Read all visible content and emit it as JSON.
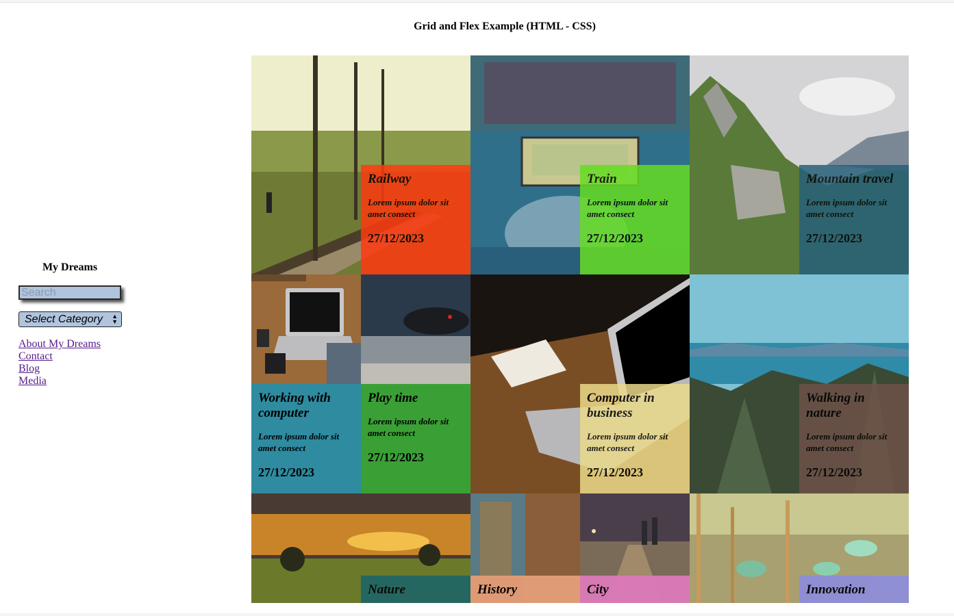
{
  "page": {
    "title": "Grid and Flex Example (HTML - CSS)"
  },
  "sidebar": {
    "title": "My Dreams",
    "search_placeholder": "Search",
    "select_label": "Select Category",
    "links": [
      "About My Dreams",
      "Contact",
      "Blog",
      "Media"
    ]
  },
  "cards": {
    "railway": {
      "title": "Railway",
      "text": "Lorem ipsum dolor sit amet consect",
      "date": "27/12/2023",
      "color": "#ff3a10"
    },
    "train": {
      "title": "Train",
      "text": "Lorem ipsum dolor sit amet consect",
      "date": "27/12/2023",
      "color": "#66dd22"
    },
    "mountain": {
      "title": "Mountain travel",
      "text": "Lorem ipsum dolor sit amet consect",
      "date": "27/12/2023",
      "color": "#27607a"
    },
    "working": {
      "title": "Working with computer",
      "text": "Lorem ipsum dolor sit amet consect",
      "date": "27/12/2023",
      "color": "#2e8ba0"
    },
    "play": {
      "title": "Play time",
      "text": "Lorem ipsum dolor sit amet consect",
      "date": "27/12/2023",
      "color": "#3aa036"
    },
    "business": {
      "title": "Computer in business",
      "text": "Lorem ipsum dolor sit amet consect",
      "date": "27/12/2023",
      "color": "#ead98a"
    },
    "walking": {
      "title": "Walking in nature",
      "text": "Lorem ipsum dolor sit amet consect",
      "date": "27/12/2023",
      "color": "#6e5248"
    },
    "nature": {
      "title": "Nature",
      "color": "#1f6466"
    },
    "history": {
      "title": "History",
      "color": "#e6a07a"
    },
    "city": {
      "title": "City",
      "color": "#dd7ab8"
    },
    "innovation": {
      "title": "Innovation",
      "color": "#8e8ed8"
    }
  }
}
